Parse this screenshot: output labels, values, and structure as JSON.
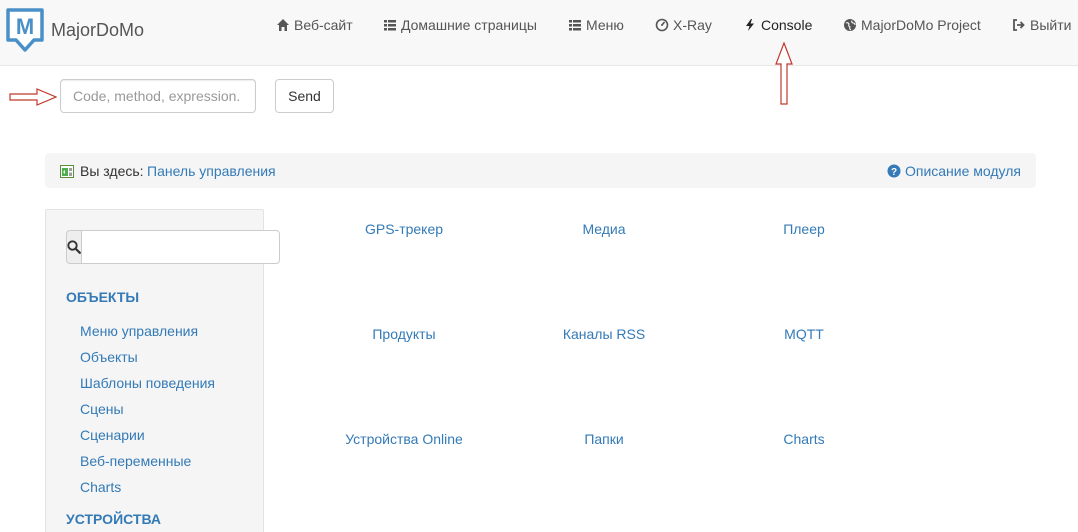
{
  "brand": {
    "name": "MajorDoMo",
    "logo_letter": "M"
  },
  "navbar": {
    "items": [
      {
        "label": "Веб-сайт",
        "icon": "home-icon"
      },
      {
        "label": "Домашние страницы",
        "icon": "list-icon"
      },
      {
        "label": "Меню",
        "icon": "list-icon"
      },
      {
        "label": "X-Ray",
        "icon": "dashboard-icon"
      },
      {
        "label": "Console",
        "icon": "flash-icon",
        "active": true
      },
      {
        "label": "MajorDoMo Project",
        "icon": "globe-icon"
      },
      {
        "label": "Выйти",
        "icon": "logout-icon"
      }
    ]
  },
  "console": {
    "placeholder": "Code, method, expression.",
    "send_label": "Send"
  },
  "breadcrumb": {
    "prefix": "Вы здесь:",
    "current": "Панель управления",
    "module_description": "Описание модуля"
  },
  "sidebar": {
    "search_value": "",
    "section_objects": "ОБЪЕКТЫ",
    "items": [
      "Меню управления",
      "Объекты",
      "Шаблоны поведения",
      "Сцены",
      "Сценарии",
      "Веб-переменные",
      "Charts"
    ],
    "section_devices": "УСТРОЙСТВА"
  },
  "modules": [
    [
      "GPS-трекер",
      "Медиа",
      "Плеер"
    ],
    [
      "Продукты",
      "Каналы RSS",
      "MQTT"
    ],
    [
      "Устройства Online",
      "Папки",
      "Charts"
    ]
  ],
  "colors": {
    "link": "#337ab7",
    "navbar_bg": "#f8f8f8",
    "brand_logo": "#4a90c8",
    "annotation_arrow": "#c0392b"
  }
}
